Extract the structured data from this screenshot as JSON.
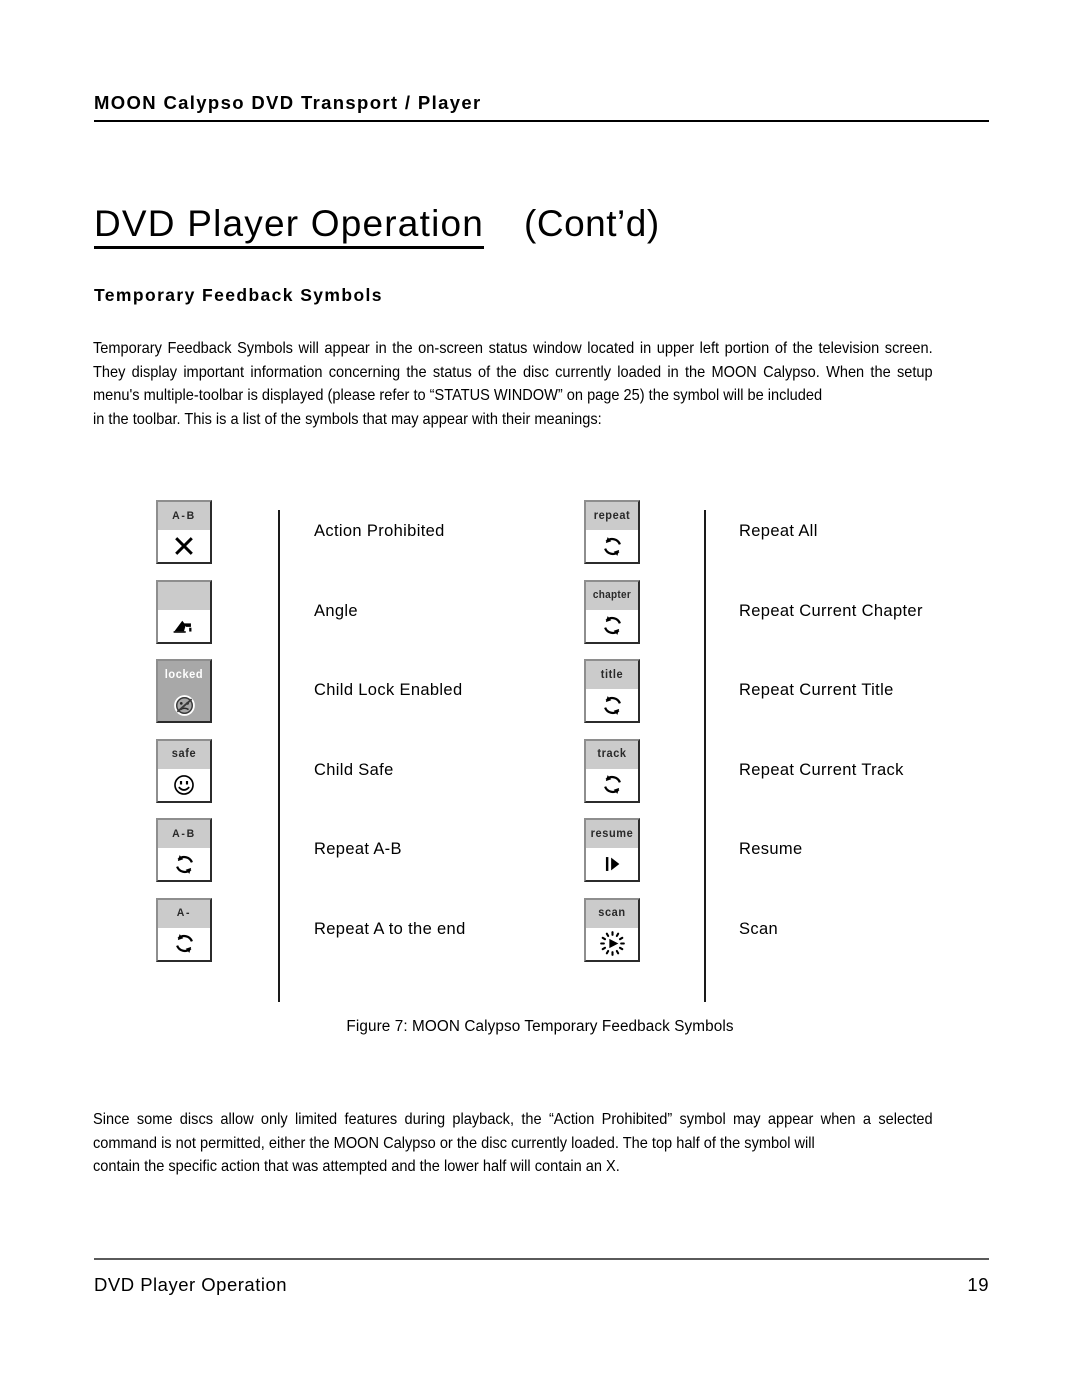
{
  "header": {
    "running_title": "MOON Calypso DVD Transport /  Player"
  },
  "title": {
    "main": "DVD Player Operation",
    "continued": "(Cont’d)"
  },
  "section": {
    "heading": "Temporary Feedback Symbols",
    "intro_main": "Temporary Feedback Symbols will appear in the on-screen status window located in upper left portion of the television screen. They display important information concerning the status of the disc currently loaded in the MOON Calypso.  When the setup menu's multiple-toolbar is displayed (please refer to “STATUS WINDOW” on page 25) the symbol will be included",
    "intro_last": "in the toolbar. This is a list of the symbols that may appear with their meanings:"
  },
  "figure": {
    "caption": "Figure 7:  MOON Calypso Temporary Feedback Symbols",
    "left_column": [
      {
        "box_label": "A-B",
        "icon": "x-cross-icon",
        "label": "Action Prohibited",
        "style": "split"
      },
      {
        "box_label": "",
        "icon": "camera-angle-icon",
        "label": "Angle",
        "style": "split"
      },
      {
        "box_label": "locked",
        "icon": "locked-face-icon",
        "label": "Child Lock Enabled",
        "style": "allgray"
      },
      {
        "box_label": "safe",
        "icon": "smiley-face-icon",
        "label": "Child Safe",
        "style": "split"
      },
      {
        "box_label": "A-B",
        "icon": "repeat-loop-icon",
        "label": "Repeat A-B",
        "style": "split"
      },
      {
        "box_label": "A-",
        "icon": "repeat-loop-icon",
        "label": "Repeat A to the end",
        "style": "split"
      }
    ],
    "right_column": [
      {
        "box_label": "repeat",
        "icon": "repeat-loop-icon",
        "label": "Repeat All",
        "style": "split"
      },
      {
        "box_label": "chapter",
        "icon": "repeat-loop-icon",
        "label": "Repeat Current Chapter",
        "style": "split"
      },
      {
        "box_label": "title",
        "icon": "repeat-loop-icon",
        "label": "Repeat Current Title",
        "style": "split"
      },
      {
        "box_label": "track",
        "icon": "repeat-loop-icon",
        "label": "Repeat Current Track",
        "style": "split"
      },
      {
        "box_label": "resume",
        "icon": "resume-play-icon",
        "label": "Resume",
        "style": "split"
      },
      {
        "box_label": "scan",
        "icon": "scan-play-icon",
        "label": "Scan",
        "style": "split"
      }
    ]
  },
  "closing": {
    "main": "Since some discs allow only limited features during playback, the “Action Prohibited” symbol may appear when a selected command is not permitted, either the  MOON Calypso or the disc currently loaded.   The top half of the symbol will",
    "last": "contain the specific action that was attempted and the lower half will contain an X."
  },
  "footer": {
    "section_name": "DVD Player Operation",
    "page_number": "19"
  },
  "colors": {
    "gray_band": "#cbcbcb",
    "gray_solid": "#a8a8a8",
    "ink": "#000000"
  }
}
